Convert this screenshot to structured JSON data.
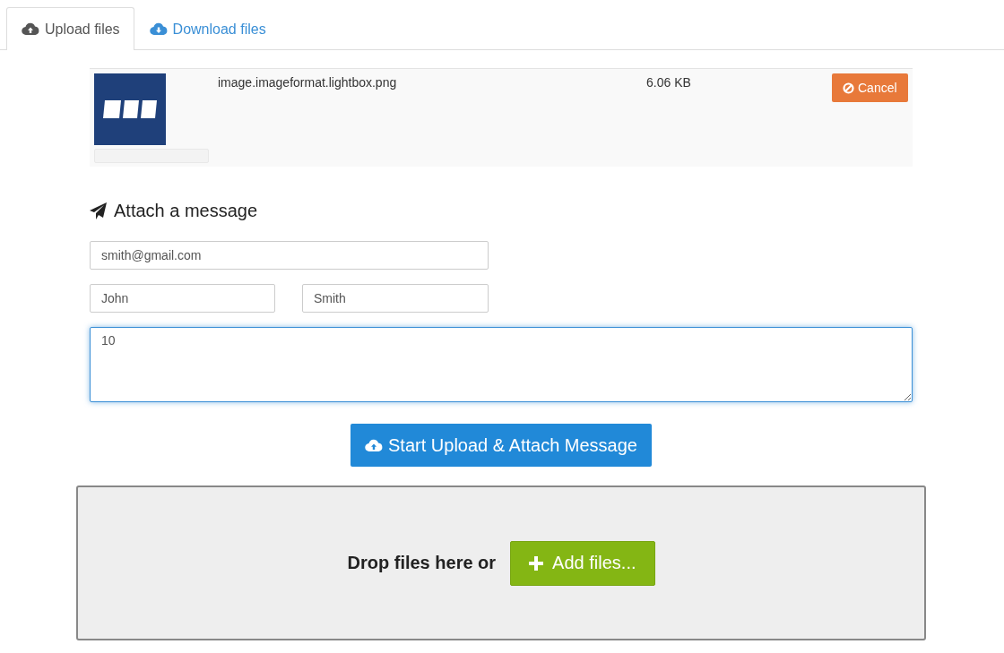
{
  "tabs": [
    {
      "label": "Upload files",
      "selected": true
    },
    {
      "label": "Download files",
      "selected": false
    }
  ],
  "files": [
    {
      "name": "image.imageformat.lightbox.png",
      "size": "6.06 KB",
      "progress": {
        "level": 0
      },
      "cancel_button": "Cancel"
    }
  ],
  "message": {
    "heading": "Attach a message",
    "email": {
      "value": "smith@gmail.com"
    },
    "first_name": {
      "value": "John"
    },
    "last_name": {
      "value": "Smith"
    },
    "message": {
      "value": "10",
      "focused": true
    }
  },
  "start_button": "Start Upload & Attach Message",
  "dropzone": {
    "text": "Drop files here or",
    "add_button": "Add files..."
  }
}
